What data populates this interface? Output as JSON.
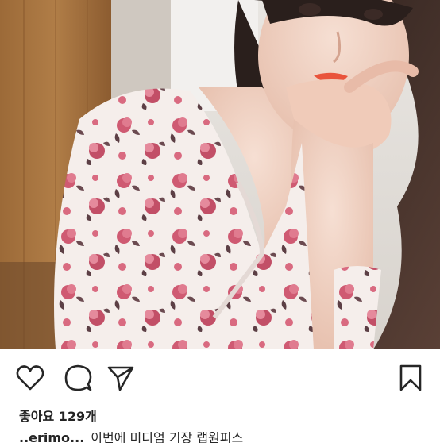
{
  "post": {
    "likes_text": "좋아요 129개",
    "caption_username": "..erimo...",
    "caption_text": "이번에 미디엄 기장 랩원피스"
  },
  "icons": {
    "like": "heart-icon",
    "comment": "comment-icon",
    "share": "paper-plane-icon",
    "save": "bookmark-icon"
  },
  "colors": {
    "icon_stroke": "#262626",
    "text": "#262626",
    "dress_base": "#f4ece9",
    "flower_pink": "#c9556b",
    "flower_dark": "#5c3f45",
    "wall_wood": "#a8753f"
  }
}
